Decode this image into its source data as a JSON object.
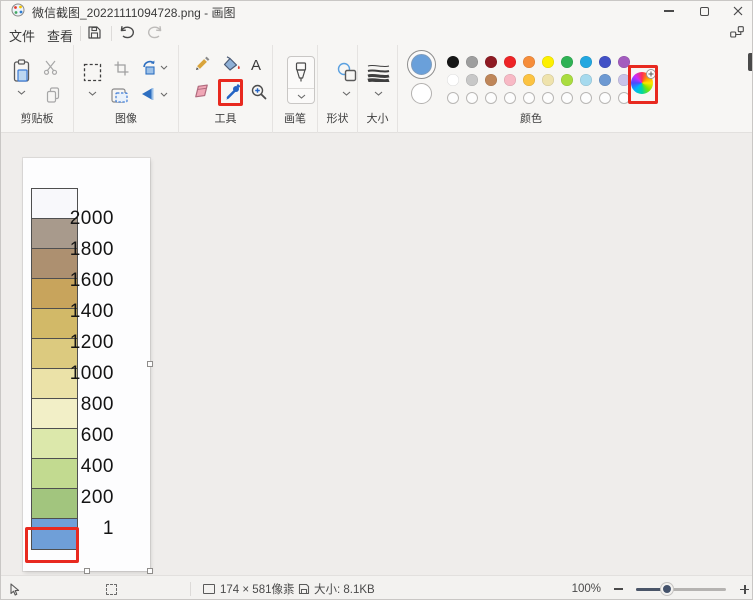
{
  "window": {
    "title": "微信截图_20221111094728.png - 画图"
  },
  "menu": {
    "file": "文件",
    "view": "查看"
  },
  "ribbon": {
    "labels": {
      "clipboard": "剪贴板",
      "image": "图像",
      "tools": "工具",
      "brushes": "画笔",
      "shapes": "形状",
      "size": "大小",
      "colors": "颜色"
    },
    "tool_icons": [
      "pencil",
      "fill",
      "text",
      "eraser",
      "eyedropper",
      "magnifier"
    ]
  },
  "colors": {
    "color1": "#6aa0da",
    "color2": "#ffffff",
    "row1": [
      "#161616",
      "#9e9e9e",
      "#8e1a22",
      "#ee2426",
      "#f68d3a",
      "#fdf000",
      "#2fb254",
      "#22a7e0",
      "#4251c6",
      "#a35cbe"
    ],
    "row2": [
      "#ffffff",
      "#c8c8c8",
      "#bf8659",
      "#f8b9c5",
      "#fcc342",
      "#efe3ad",
      "#aadd3f",
      "#a6daee",
      "#6d99d2",
      "#c8c2e8"
    ],
    "empty_slots": 10
  },
  "canvas": {
    "legend_labels": [
      "2000",
      "1800",
      "1600",
      "1400",
      "1200",
      "1000",
      "800",
      "600",
      "400",
      "200",
      "1"
    ],
    "legend_colors": [
      "#f8f8fb",
      "#a89a8c",
      "#ad9070",
      "#c8a45c",
      "#d2b968",
      "#dcca7f",
      "#ebe2a8",
      "#f2efc7",
      "#dce8ab",
      "#c2da90",
      "#a2c57e",
      "#6f9fd8"
    ]
  },
  "annotations": {
    "highlight_color": "#e8291f"
  },
  "status": {
    "canvas_size": "174 × 581像素",
    "file_size": "大小: 8.1KB",
    "zoom": "100%"
  }
}
